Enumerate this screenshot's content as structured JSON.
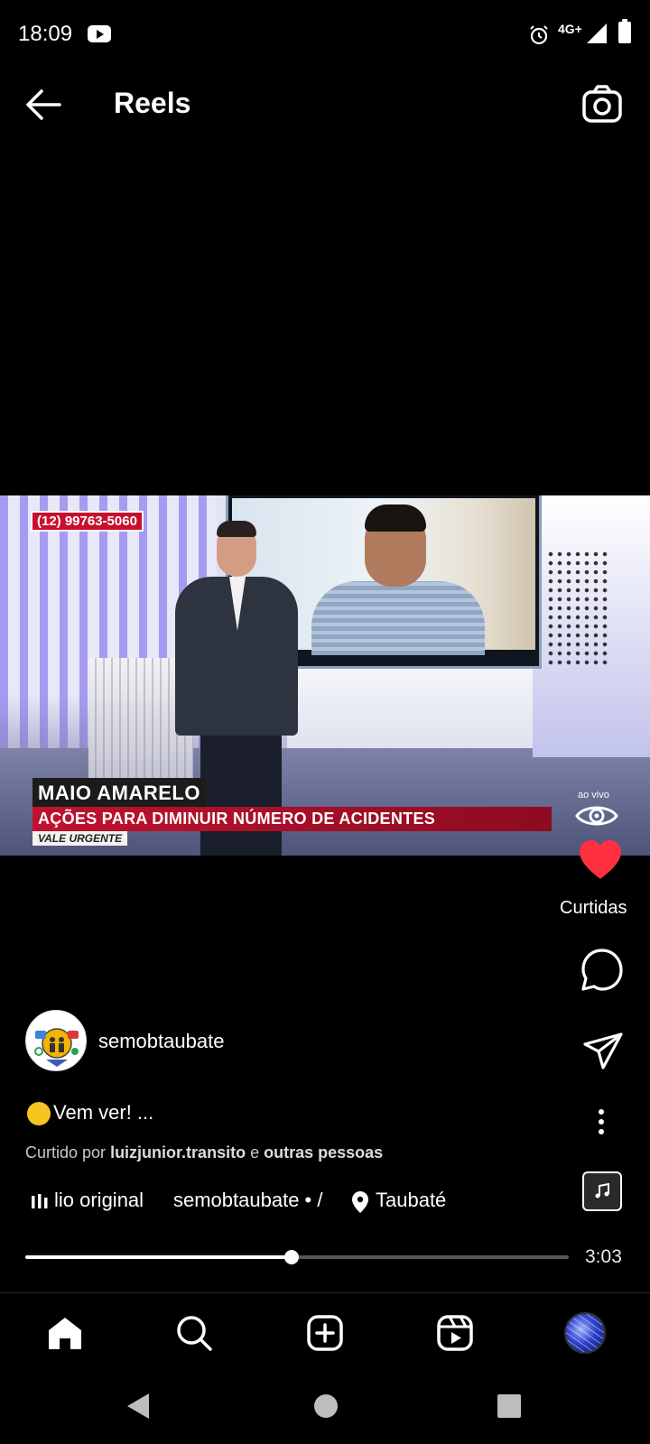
{
  "status_bar": {
    "time": "18:09",
    "network": "4G+",
    "icons": [
      "youtube-icon",
      "alarm-icon",
      "signal-icon",
      "battery-icon"
    ]
  },
  "header": {
    "title": "Reels",
    "back_icon": "arrow-left",
    "camera_icon": "camera"
  },
  "video": {
    "phone_tag": "(12) 99763-5060",
    "headline": "MAIO AMARELO",
    "subline": "AÇÕES PARA DIMINUIR NÚMERO DE ACIDENTES",
    "tag": "VALE URGENTE",
    "live_label": "ao vivo"
  },
  "actions": {
    "like_label": "Curtidas",
    "like_color": "#ff3040"
  },
  "post": {
    "username": "semobtaubate",
    "caption": "Vem ver! ...",
    "liked_by_prefix": "Curtido por",
    "liked_by_user": "luizjunior.transito",
    "liked_by_conj": "e",
    "liked_by_others": "outras pessoas",
    "audio_name": "lio original",
    "audio_artist": "semobtaubate • /",
    "location": "Taubaté"
  },
  "playback": {
    "progress_fraction": 0.49,
    "duration": "3:03"
  },
  "bottom_nav": {
    "items": [
      "home-icon",
      "search-icon",
      "create-icon",
      "reels-icon",
      "profile-avatar"
    ]
  }
}
